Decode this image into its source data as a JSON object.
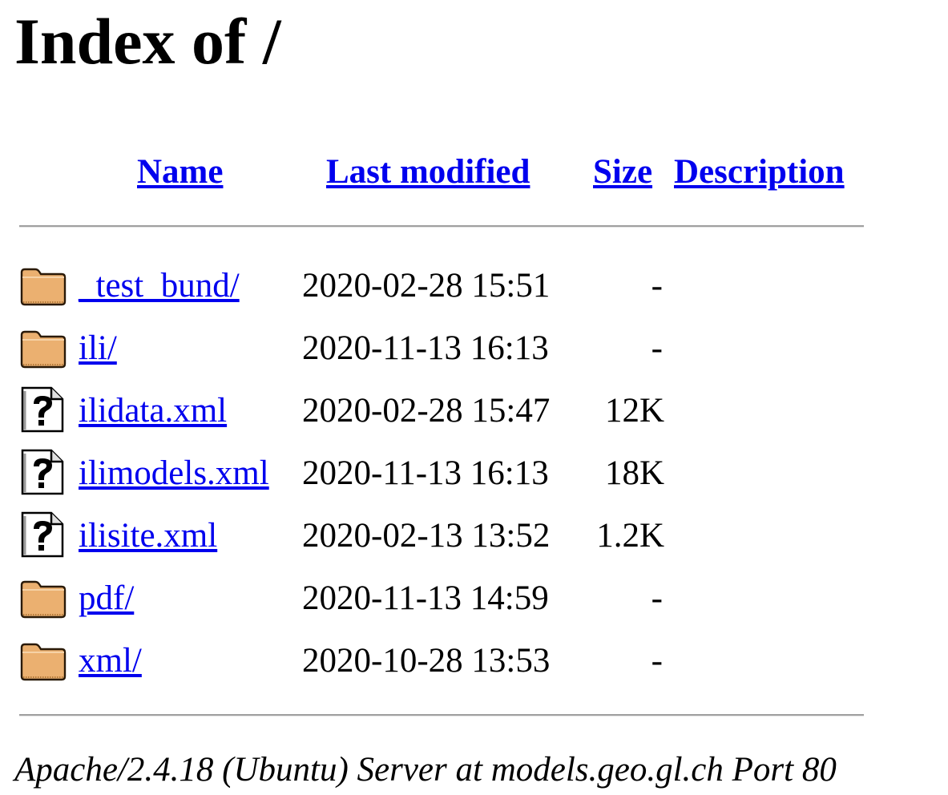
{
  "page": {
    "title": "Index of /"
  },
  "columns": {
    "name": "Name",
    "last_modified": "Last modified",
    "size": "Size",
    "description": "Description"
  },
  "rows": [
    {
      "icon": "folder-icon",
      "name": "_test_bund/",
      "date": "2020-02-28 15:51",
      "size": "-",
      "description": ""
    },
    {
      "icon": "folder-icon",
      "name": "ili/",
      "date": "2020-11-13 16:13",
      "size": "-",
      "description": ""
    },
    {
      "icon": "unknown-file-icon",
      "name": "ilidata.xml",
      "date": "2020-02-28 15:47",
      "size": "12K",
      "description": ""
    },
    {
      "icon": "unknown-file-icon",
      "name": "ilimodels.xml",
      "date": "2020-11-13 16:13",
      "size": "18K",
      "description": ""
    },
    {
      "icon": "unknown-file-icon",
      "name": "ilisite.xml",
      "date": "2020-02-13 13:52",
      "size": "1.2K",
      "description": ""
    },
    {
      "icon": "folder-icon",
      "name": "pdf/",
      "date": "2020-11-13 14:59",
      "size": "-",
      "description": ""
    },
    {
      "icon": "folder-icon",
      "name": "xml/",
      "date": "2020-10-28 13:53",
      "size": "-",
      "description": ""
    }
  ],
  "footer": {
    "server_signature": "Apache/2.4.18 (Ubuntu) Server at models.geo.gl.ch Port 80"
  },
  "colors": {
    "link": "#0000EE",
    "folder_fill": "#EBB070",
    "rule": "#A0A0A0"
  }
}
